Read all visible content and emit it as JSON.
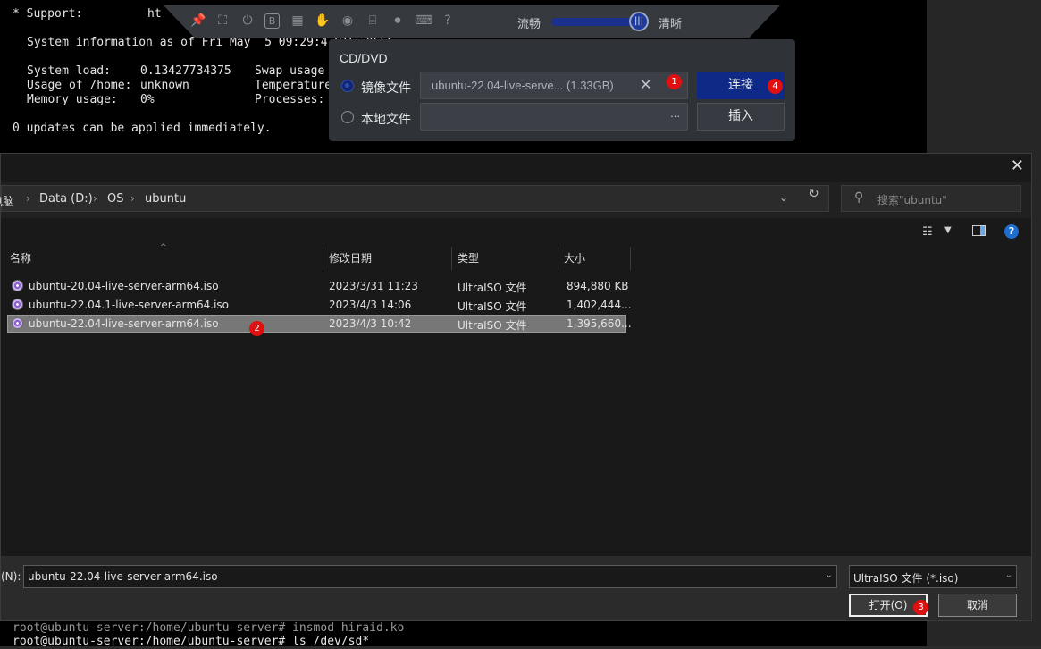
{
  "terminal": {
    "support_label": "* Support:",
    "support_value": "ht",
    "sysinfo": "System information as of Fri May  5 09:29:4",
    "sysinfo_tail": "UTC 2023",
    "load_label": "System load:",
    "load_value": "0.13427734375",
    "home_label": "Usage of /home:",
    "home_value": "unknown",
    "mem_label": "Memory usage:",
    "mem_value": "0%",
    "swap_label": "Swap usage",
    "temp_label": "Temperature",
    "proc_label": "Processes:",
    "updates": "0 updates can be applied immediately.",
    "bottom_line_1": "root@ubuntu-server:/home/ubuntu-server# insmod hiraid.ko",
    "bottom_line_2": "root@ubuntu-server:/home/ubuntu-server# ls /dev/sd*"
  },
  "toolbar": {
    "icons": [
      "pin-icon",
      "fullscreen-icon",
      "power-icon",
      "bios-icon",
      "media-icon",
      "mouse-icon",
      "disc-icon",
      "usb-icon",
      "record-icon",
      "keyboard-icon",
      "help-icon"
    ],
    "quality_smooth": "流畅",
    "quality_clear": "清晰",
    "quality_level": 0.95
  },
  "cd_panel": {
    "title": "CD/DVD",
    "image_option": "镜像文件",
    "image_value": "ubuntu-22.04-live-serve... (1.33GB)",
    "local_option": "本地文件",
    "local_value": "...",
    "connect": "连接",
    "insert": "插入"
  },
  "badges": [
    "1",
    "2",
    "3",
    "4"
  ],
  "dialog": {
    "close": "✕",
    "breadcrumb": [
      "电脑",
      "Data (D:)",
      "OS",
      "ubuntu"
    ],
    "search_placeholder": "搜索\"ubuntu\"",
    "columns": {
      "name": "名称",
      "date": "修改日期",
      "type": "类型",
      "size": "大小"
    },
    "files": [
      {
        "name": "ubuntu-20.04-live-server-arm64.iso",
        "date": "2023/3/31 11:23",
        "type": "UltraISO 文件",
        "size": "894,880 KB",
        "selected": false
      },
      {
        "name": "ubuntu-22.04.1-live-server-arm64.iso",
        "date": "2023/4/3 14:06",
        "type": "UltraISO 文件",
        "size": "1,402,444...",
        "selected": false
      },
      {
        "name": "ubuntu-22.04-live-server-arm64.iso",
        "date": "2023/4/3 10:42",
        "type": "UltraISO 文件",
        "size": "1,395,660...",
        "selected": true
      }
    ],
    "filename_label": "(N):",
    "filename_value": "ubuntu-22.04-live-server-arm64.iso",
    "filetype_value": "UltraISO 文件 (*.iso)",
    "open": "打开(O)",
    "cancel": "取消"
  }
}
